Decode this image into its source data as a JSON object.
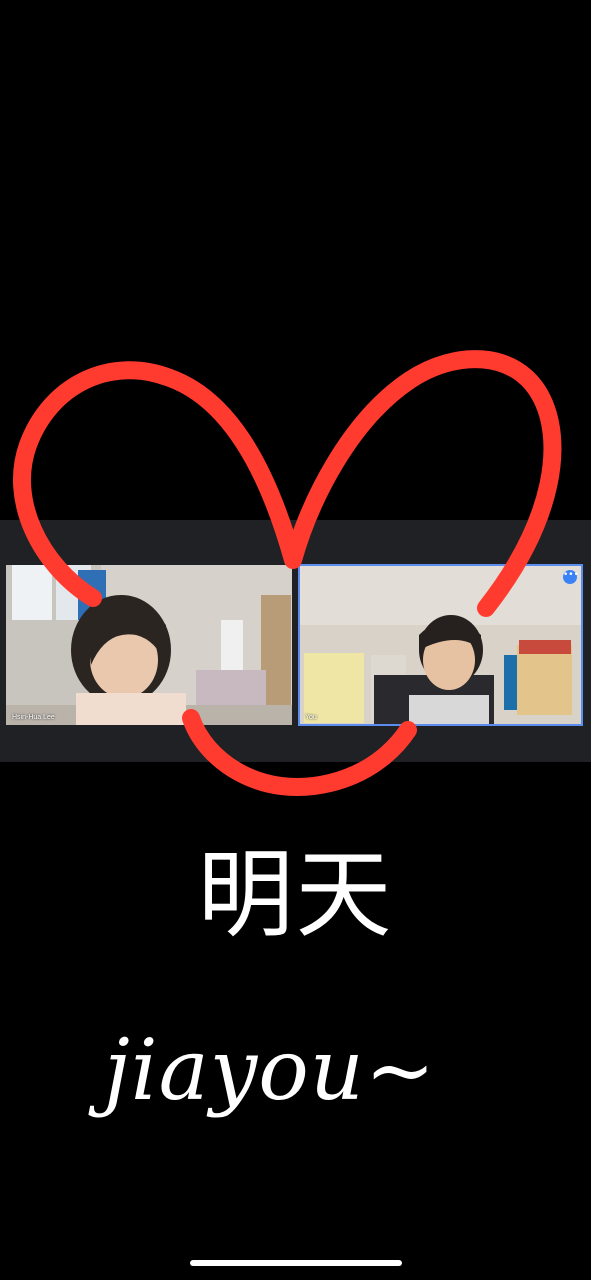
{
  "call": {
    "participants": [
      {
        "name": "Hsin-Hua Lee"
      },
      {
        "name": "You",
        "more_icon": "more-options-icon",
        "more_label": "•••"
      }
    ],
    "active_highlight_color": "#5b8def"
  },
  "annotation": {
    "heart_color": "#ff3b30",
    "chinese_caption": "明天",
    "cursive_caption": "jiayou~"
  },
  "system": {
    "home_indicator": "home-indicator"
  }
}
